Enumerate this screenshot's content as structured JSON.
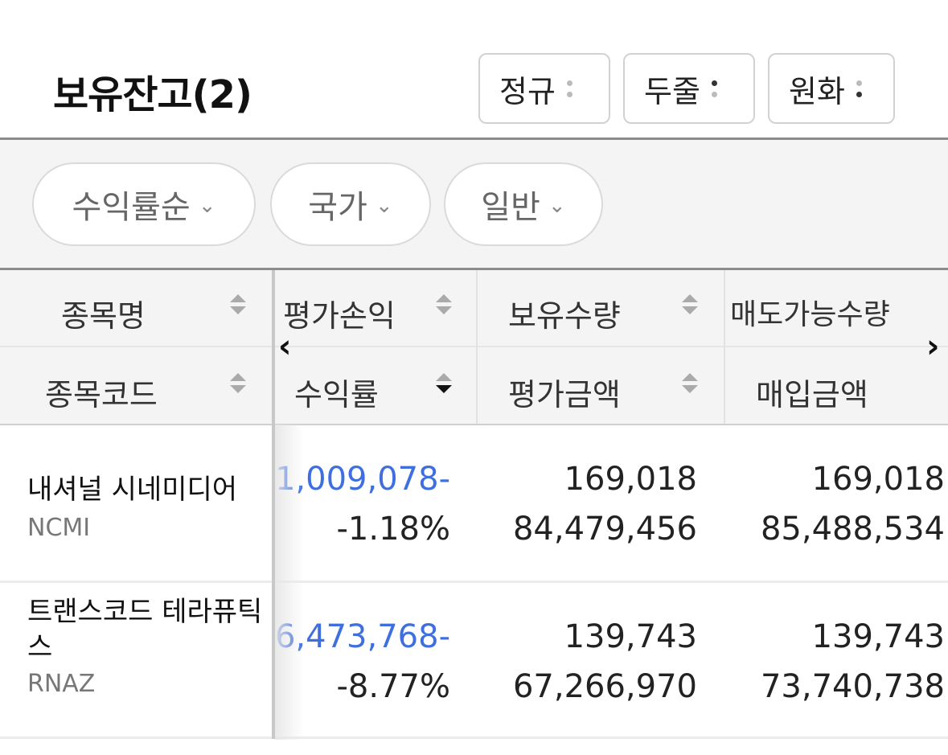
{
  "header": {
    "title": "보유잔고(2)",
    "buttons": [
      {
        "label": "정규"
      },
      {
        "label": "두줄"
      },
      {
        "label": "원화"
      }
    ]
  },
  "filters": [
    {
      "label": "수익률순"
    },
    {
      "label": "국가"
    },
    {
      "label": "일반"
    }
  ],
  "table": {
    "headers_top": [
      "종목명",
      "평가손익",
      "보유수량",
      "매도가능수량"
    ],
    "headers_bottom": [
      "종목코드",
      "수익률",
      "평가금액",
      "매입금액"
    ],
    "sort_active": "수익률 descending",
    "rows": [
      {
        "name": "내셔널 시네미디어",
        "code": "NCMI",
        "pnl": "-1,009,078",
        "rate": "-1.18%",
        "qty": "169,018",
        "eval": "84,479,456",
        "sellable": "169,018",
        "buy": "85,488,534"
      },
      {
        "name": "트랜스코드 테라퓨틱스",
        "code": "RNAZ",
        "pnl": "-6,473,768",
        "rate": "-8.77%",
        "qty": "139,743",
        "eval": "67,266,970",
        "sellable": "139,743",
        "buy": "73,740,738"
      }
    ]
  },
  "colors": {
    "negative_pnl": "#3f6fdf",
    "header_bg": "#f4f4f4"
  }
}
